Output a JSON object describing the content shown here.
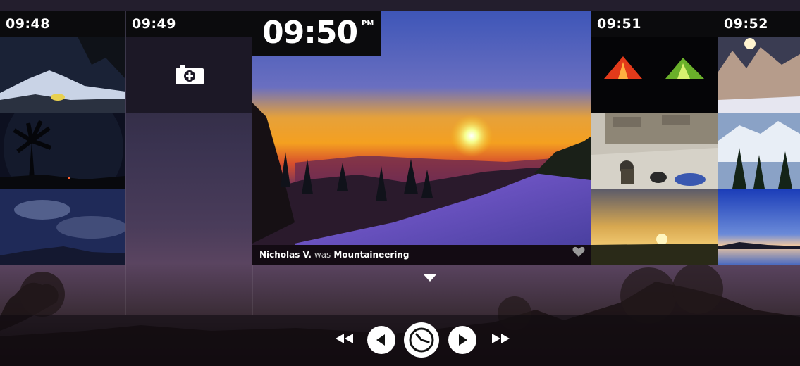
{
  "columns": [
    {
      "time": "09:48"
    },
    {
      "time": "09:49"
    },
    {
      "time": "09:51"
    },
    {
      "time": "09:52"
    }
  ],
  "featured": {
    "time": "09:50",
    "ampm": "PM",
    "user": "Nicholas V.",
    "verb": "was",
    "activity": "Mountaineering"
  },
  "icons": {
    "camera": "camera-add-icon",
    "heart": "heart-icon",
    "expand": "chevron-down-icon",
    "rewind": "fast-rewind-icon",
    "prev": "previous-icon",
    "clock": "clock-icon",
    "next": "next-icon",
    "forward": "fast-forward-icon"
  }
}
